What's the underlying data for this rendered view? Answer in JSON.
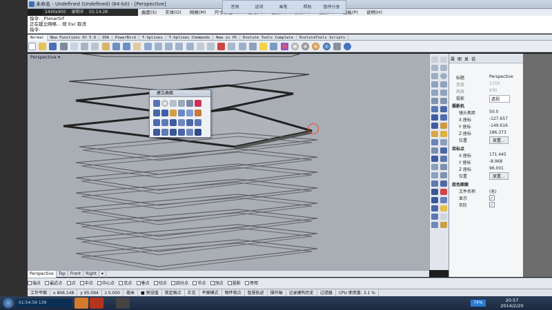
{
  "window": {
    "title": "未命名 - Undefined (Undefined) (64-bit) - [Perspective]",
    "recorder": [
      "1440x900",
      "录制中",
      "01:14:28"
    ]
  },
  "overlay_buttons": [
    "音频",
    "选项",
    "画笔",
    "帮助",
    "暂停分享"
  ],
  "menubar": [
    "曲面(S)",
    "实体(O)",
    "网格(M)",
    "尺寸标注(D)",
    "变动(T)",
    "工具(L)",
    "分析(A)",
    "渲染(R)",
    "面板(P)",
    "说明(H)"
  ],
  "command": {
    "line1": "指令: _PlanarSrf",
    "line2": "正在建立网格... 按 Esc 取消",
    "prompt": "指令:"
  },
  "tabs": [
    "Normal",
    "New Functions Of 5.0",
    "ZOA",
    "PowerBird",
    "T-Splines",
    "T-Splines Commands",
    "New in V5",
    "Evolute Tools Complete",
    "EvoluteTools Scripts"
  ],
  "viewport": {
    "label": "Perspective",
    "dropdown": "▾"
  },
  "float_panel": {
    "title": "建立曲面"
  },
  "properties": {
    "tabs": [
      "属",
      "图",
      "显",
      "说"
    ],
    "rows": [
      {
        "label": "标题",
        "value": "Perspective"
      },
      {
        "label": "宽度",
        "value": "1150"
      },
      {
        "label": "高度",
        "value": "630"
      },
      {
        "label": "投影",
        "value": "透视"
      }
    ],
    "camera_header": "摄影机",
    "camera": [
      {
        "label": "镜头焦距",
        "value": "50.0"
      },
      {
        "label": "X 座标",
        "value": "-127.657"
      },
      {
        "label": "Y 座标",
        "value": "-149.616"
      },
      {
        "label": "Z 座标",
        "value": "186.373"
      }
    ],
    "location_label": "位置",
    "place_button": "放置...",
    "target_header": "目标点",
    "target": [
      {
        "label": "X 座标",
        "value": "171.445"
      },
      {
        "label": "Y 座标",
        "value": "-8.968"
      },
      {
        "label": "Z 座标",
        "value": "96.001"
      }
    ],
    "target_location": "位置",
    "target_button": "放置...",
    "wallpaper_header": "底色图案",
    "wallpaper": [
      {
        "label": "文件名称",
        "value": "(无)"
      },
      {
        "label": "显示",
        "value": "✓"
      },
      {
        "label": "灰阶",
        "value": "✓"
      }
    ]
  },
  "viewtabs": [
    "Perspective",
    "Top",
    "Front",
    "Right",
    "▾"
  ],
  "osnaps": [
    "端点",
    "最近点",
    "点",
    "中点",
    "中心点",
    "交点",
    "垂点",
    "切点",
    "四分点",
    "节点",
    "顶点",
    "投影",
    "停用"
  ],
  "status": [
    "工作平面",
    "x 806.148",
    "y 95.094",
    "z 0.000",
    "毫米",
    "■ 预设值",
    "锁定格点",
    "正交",
    "平面模式",
    "物件锁点",
    "智慧轨迹",
    "操作轴",
    "记录建构历史",
    "过滤器",
    "CPU 使用量: 3.1 %"
  ],
  "taskbar": {
    "clock_time": "20:57",
    "clock_date": "2014/2/20",
    "battery": "74%",
    "rec_counter": "01:54:59",
    "rec_count": "139"
  },
  "colors": {
    "viewport_bg": "#a9aeb5",
    "accent": "#3c6db0"
  }
}
